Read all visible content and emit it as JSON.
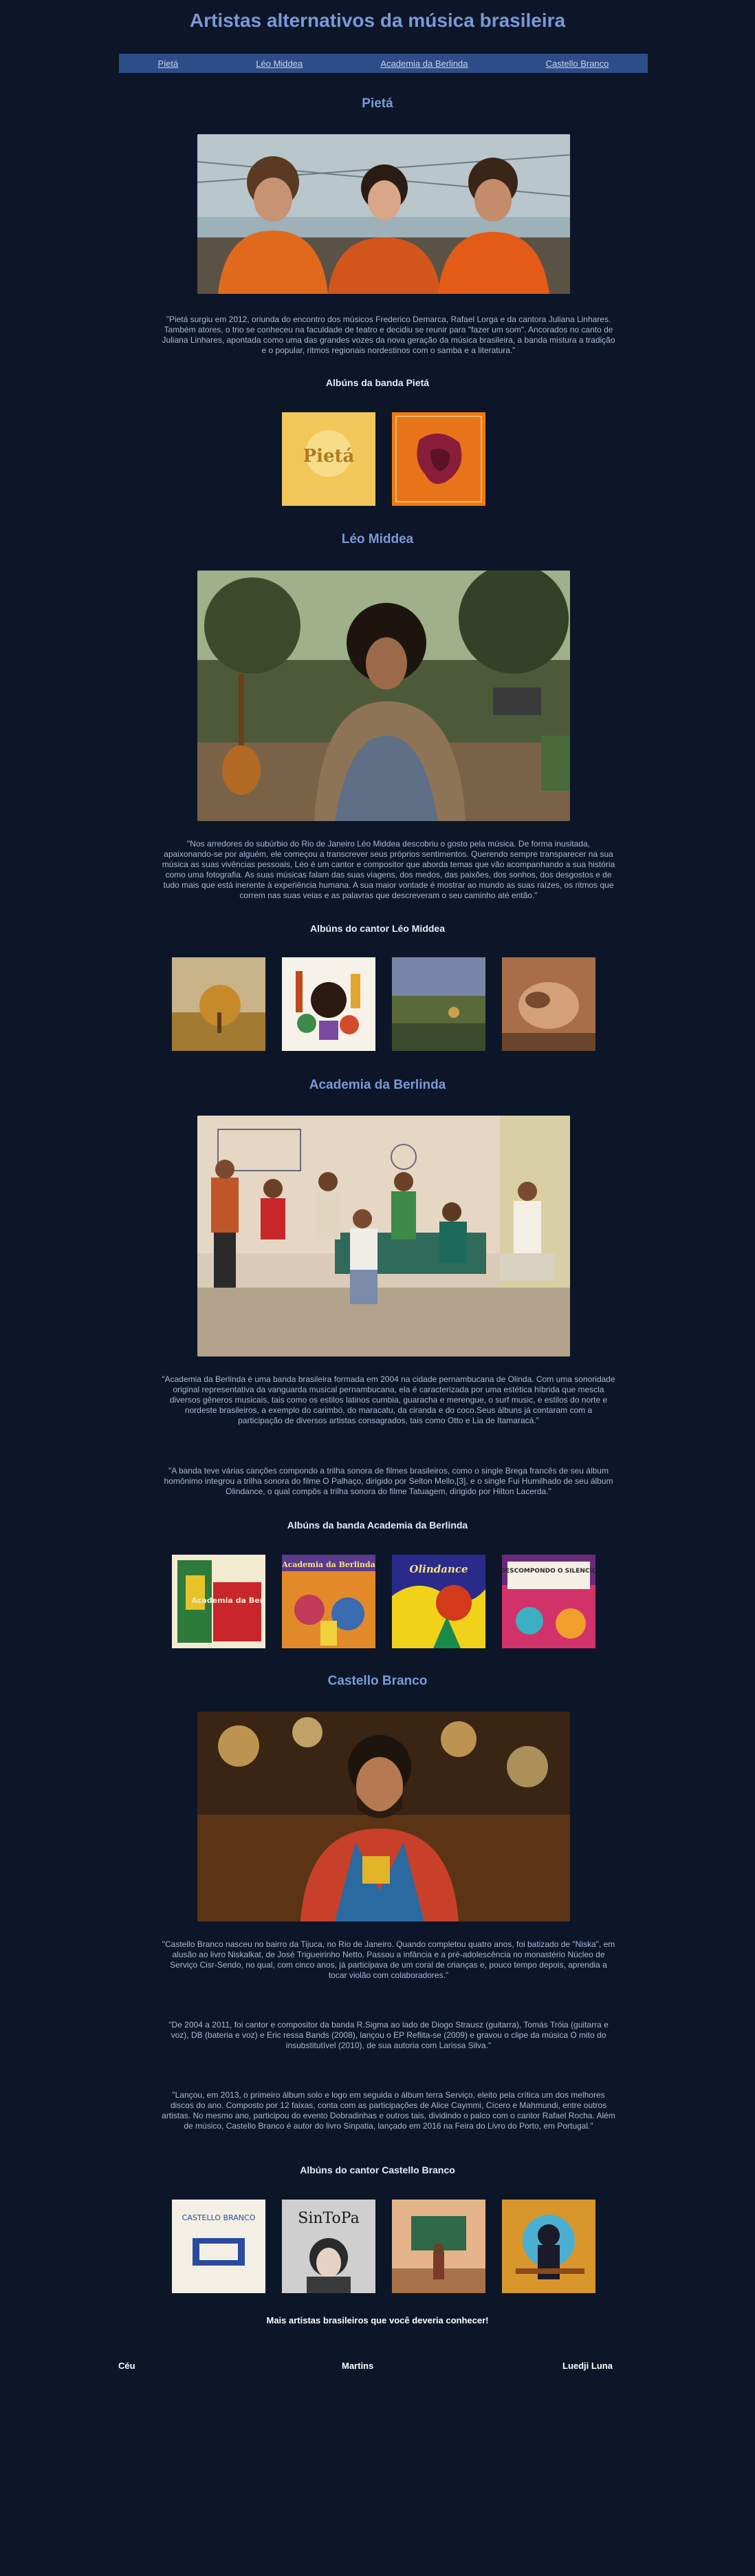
{
  "page": {
    "title": "Artistas alternativos da música brasileira"
  },
  "nav": {
    "items": [
      "Pietá",
      "Léo Middea",
      "Academia da Berlinda",
      "Castello Branco"
    ]
  },
  "sections": [
    {
      "title": "Pietá",
      "paragraphs": [
        "\"Pietá surgiu em 2012, oriunda do encontro dos músicos Frederico Demarca, Rafael Lorga e da cantora Juliana Linhares. Também atores, o trio se conheceu na faculdade de teatro e decidiu se reunir para \"fazer um som\". Ancorados no canto de Juliana Linhares, apontada como uma das grandes vozes da nova geração da música brasileira, a banda mistura a tradição e o popular, ritmos regionais nordestinos com o samba e a literatura.\""
      ],
      "albums_title": "Albúns da banda Pietá"
    },
    {
      "title": "Léo Middea",
      "paragraphs": [
        "\"Nos arredores do subúrbio do Rio de Janeiro Léo Middea descobriu o gosto pela música. De forma inusitada, apaixonando-se por alguém, ele começou a transcrever seus próprios sentimentos. Querendo sempre transparecer na sua música as suas vivências pessoais, Léo é um cantor e compositor que aborda temas que vão acompanhando a sua história como uma fotografia. As suas músicas falam das suas viagens, dos medos, das paixões, dos sonhos, dos desgostos e de tudo mais que está inerente à experiência humana. A sua maior vontade é mostrar ao mundo as suas raízes, os ritmos que correm nas suas veias e as palavras que descreveram o seu caminho até então.\""
      ],
      "albums_title": "Albúns do cantor Léo Middea"
    },
    {
      "title": "Academia da Berlinda",
      "paragraphs": [
        "\"Academia da Berlinda é uma banda brasileira formada em 2004 na cidade pernambucana de Olinda. Com uma sonoridade original representativa da vanguarda musical pernambucana, ela é caracterizada por uma estética híbrida que mescla diversos gêneros musicais, tais como os estilos latinos cumbia, guaracha e merengue, o surf music, e estilos do norte e nordeste brasileiros, a exemplo do carimbó, do maracatu, da ciranda e do coco.Seus álbuns já contaram com a participação de diversos artistas consagrados, tais como Otto e Lia de Itamaracá.\"",
        "\"A banda teve várias canções compondo a trilha sonora de filmes brasileiros, como o single Brega francês de seu álbum homônimo integrou a trilha sonora do filme O Palhaço, dirigido por Selton Mello,[3], e o single Fui Humilhado de seu álbum Olindance, o qual compôs a trilha sonora do filme Tatuagem, dirigido por Hilton Lacerda.\""
      ],
      "albums_title": "Albúns da banda Academia da Berlinda"
    },
    {
      "title": "Castello Branco",
      "paragraphs": [
        "\"Castello Branco nasceu no bairro da Tijuca, no Rio de Janeiro. Quando completou quatro anos, foi batizado de \"Niska\", em alusão ao livro Niskalkat, de José Trigueirinho Netto. Passou a infância e a pré-adolescência no monastério Núcleo de Serviço Cisr-Sendo, no qual, com cinco anos, já participava de um coral de crianças e, pouco tempo depois, aprendia a tocar violão com colaboradores.\"",
        "\"De 2004 a 2011, foi cantor e compositor da banda R.Sigma ao lado de Diogo Strausz (guitarra), Tomás Tróia (guitarra e voz), DB (bateria e voz) e Eric ressa Bands (2008), lançou o EP Reflita-se (2009) e gravou o clipe da música O mito do insubstitutível (2010), de sua autoria com Larissa Silva.\"",
        "\"Lançou, em 2013, o primeiro álbum solo e logo em seguida o álbum terra Serviço, eleito pela crítica um dos melhores discos do ano. Composto por 12 faixas, conta com as participações de Alice Caymmi, Cícero e Mahmundi, entre outros artistas. No mesmo ano, participou do evento Dobradinhas e outros tais, dividindo o palco com o cantor Rafael Rocha. Além de músico, Castello Branco é autor do livro Sinpatia, lançado em 2016 na Feira do Livro do Porto, em Portugal.\""
      ],
      "albums_title": "Albúns do cantor Castello Branco"
    }
  ],
  "album_covers": {
    "pieta": [
      "Pietá",
      ""
    ],
    "berlinda": [
      "Academia da Berlinda",
      "Academia da Berlinda",
      "Olindance",
      "DESCOMPONDO O SILENCIO"
    ],
    "castello": [
      "CASTELLO BRANCO",
      "SinToPa",
      "",
      ""
    ]
  },
  "more": {
    "title": "Mais artistas brasileiros que você deveria conhecer!",
    "artists": [
      "Céu",
      "Martins",
      "Luedji Luna"
    ]
  }
}
